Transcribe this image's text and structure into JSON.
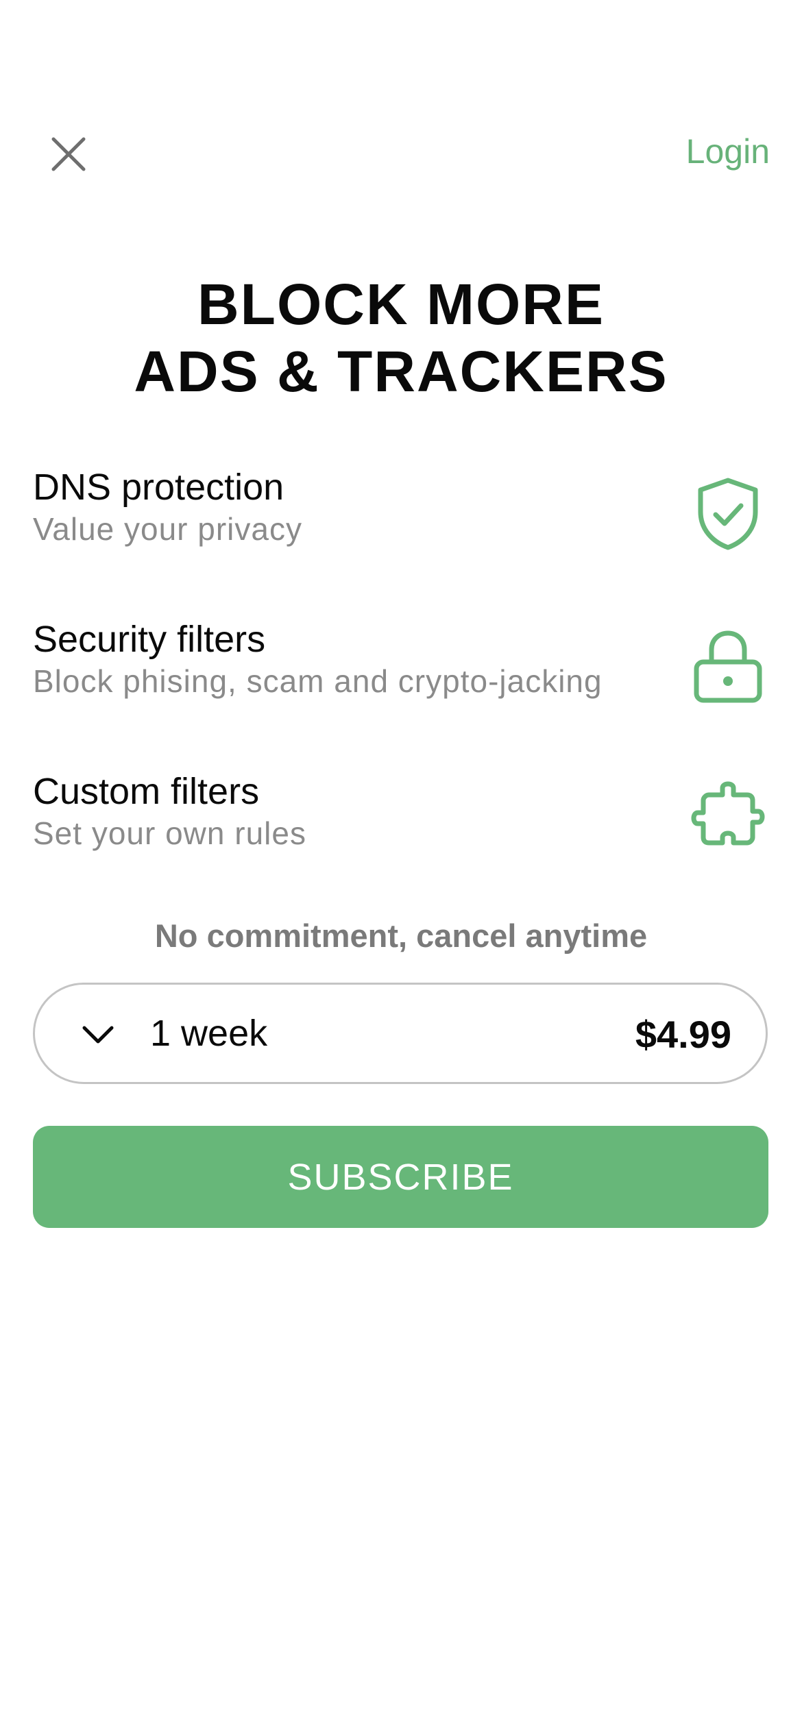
{
  "header": {
    "close_icon": "close-icon",
    "login_label": "Login"
  },
  "headline": {
    "line1": "BLOCK MORE",
    "line2": "ADS & TRACKERS"
  },
  "features": [
    {
      "title": "DNS protection",
      "subtitle": "Value your privacy",
      "icon": "shield-check-icon"
    },
    {
      "title": "Security filters",
      "subtitle": "Block phising, scam and crypto-jacking",
      "icon": "lock-icon"
    },
    {
      "title": "Custom filters",
      "subtitle": "Set your own rules",
      "icon": "puzzle-icon"
    }
  ],
  "commitment_note": "No commitment, cancel anytime",
  "plan": {
    "selected_label": "1 week",
    "price": "$4.99",
    "icon": "chevron-down-icon"
  },
  "subscribe_label": "SUBSCRIBE",
  "colors": {
    "accent": "#67b779",
    "text": "#0a0a0a",
    "muted": "#8a8a8a",
    "border": "#c4c4c4"
  }
}
